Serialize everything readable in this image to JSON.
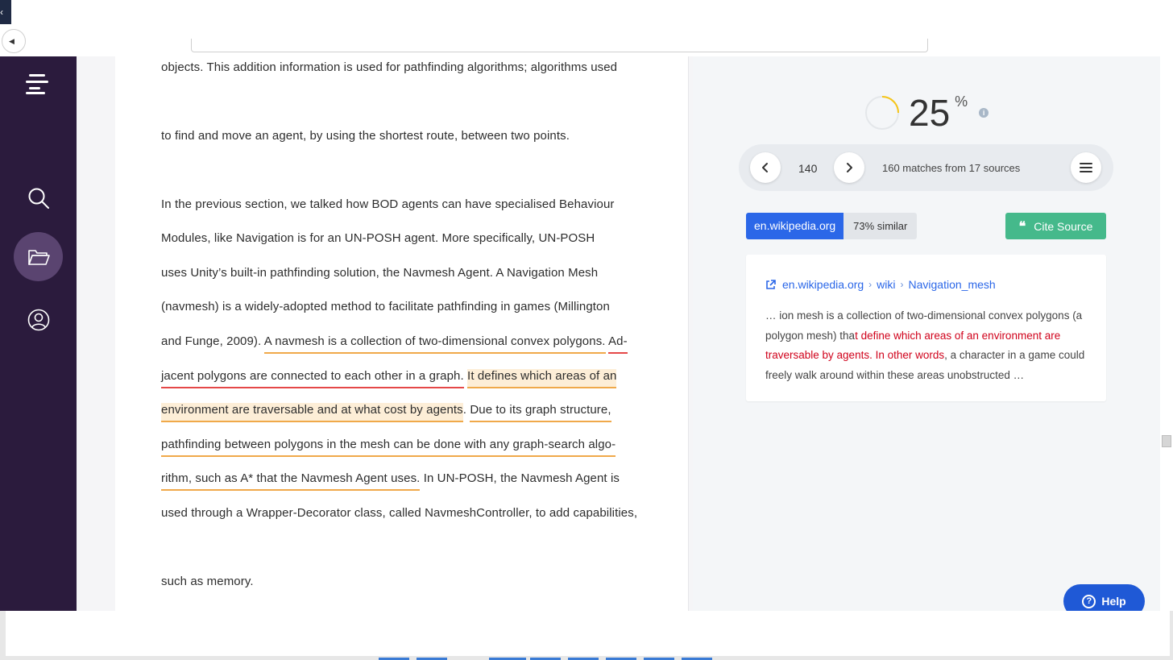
{
  "document": {
    "lines": [
      {
        "text": "objects. This addition information is used for pathfinding algorithms; algorithms used"
      },
      {
        "text": "to find and move an agent, by using the shortest route, between two points."
      },
      {
        "text": "In the previous section, we talked how BOD agents can have specialised Behaviour"
      },
      {
        "text": "Modules, like Navigation is for an UN-POSH agent. More specifically, UN-POSH"
      },
      {
        "text": "uses Unity’s built-in pathfinding solution, the Navmesh Agent. A Navigation Mesh"
      },
      {
        "text": "(navmesh) is a widely-adopted method to facilitate pathfinding in games (Millington"
      },
      {
        "a": "and Funge, 2009). ",
        "b": "A navmesh is a collection of two-dimensional convex polygons.",
        "c": " ",
        "d": "Ad-"
      },
      {
        "a": "jacent polygons are connected to each other in a graph.",
        "b": " ",
        "c": "It defines which areas of an"
      },
      {
        "a": "environment are traversable and at what cost by agents",
        "b": ". ",
        "c": "Due to its graph structure,"
      },
      {
        "a": "pathfinding between polygons in the mesh can be done with any graph-search algo-"
      },
      {
        "a": "rithm, such as A* that the Navmesh Agent uses.",
        "b": " In UN-POSH, the Navmesh Agent is"
      },
      {
        "text": "used through a Wrapper-Decorator class, called NavmeshController, to add capabilities,"
      },
      {
        "text": "such as memory."
      }
    ]
  },
  "panel": {
    "score_value": "25",
    "score_unit": "%",
    "score_percent": 25,
    "info_icon": "i",
    "current_index": "140",
    "matches_text": "160 matches from 17 sources",
    "source_domain": "en.wikipedia.org",
    "similarity_text": "73%  similar",
    "cite_label": "Cite Source",
    "breadcrumb": [
      "en.wikipedia.org",
      "wiki",
      "Navigation_mesh"
    ],
    "breadcrumb_sep": "›",
    "snippet": {
      "pre": "… ion mesh is a collection of two-dimensional convex polygons (a polygon mesh) tha",
      "match": "t define which areas of an environment are traversable by agents. In other words",
      "post": ", a character in a game could freely walk around within these areas unobstructed …"
    }
  },
  "help_label": "Help",
  "colors": {
    "sidebar": "#2b1b3d",
    "sidebar_active": "#5a4470",
    "accent_blue": "#2b67e8",
    "cite_green": "#45b98b",
    "match_red": "#d0021b",
    "underline_orange": "#f0a94a",
    "underline_red": "#e54848",
    "highlight": "#fdeed7",
    "score_ring": "#f5c518"
  },
  "icons": [
    "menu-logo-icon",
    "search-icon",
    "folder-icon",
    "user-icon",
    "chevron-left-icon",
    "chevron-right-icon",
    "hamburger-menu-icon",
    "external-link-icon",
    "quote-icon",
    "help-question-icon"
  ]
}
